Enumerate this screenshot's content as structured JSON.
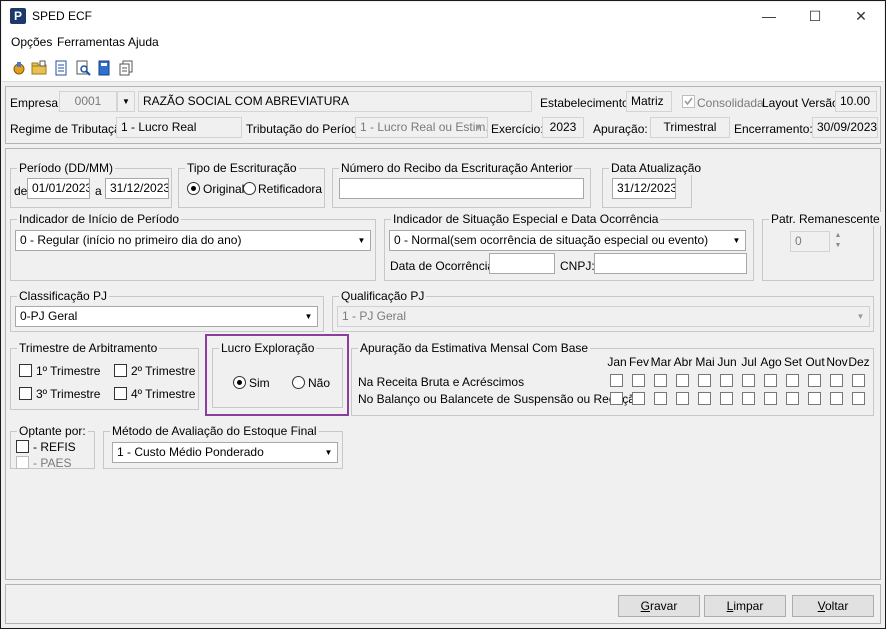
{
  "window": {
    "title": "SPED ECF",
    "logo_letter": "P",
    "minimize": "—",
    "maximize": "☐",
    "close": "✕"
  },
  "menu": [
    "Opções",
    "Ferramentas",
    "Ajuda"
  ],
  "toolbar_icons": [
    "tools-icon",
    "folder-icon",
    "document-icon",
    "search-document-icon",
    "book-icon",
    "copy-icon"
  ],
  "header": {
    "empresa_label": "Empresa:",
    "empresa_code": "0001",
    "empresa_name": "RAZÃO SOCIAL COM ABREVIATURA",
    "estabelecimento_label": "Estabelecimento:",
    "estabelecimento_value": "Matriz",
    "consolidada_label": "Consolidada",
    "layout_label": "Layout Versão:",
    "layout_value": "10.00",
    "regime_label": "Regime de Tributação:",
    "regime_value": "1 - Lucro Real",
    "tributacao_label": "Tributação do Período:",
    "tributacao_value": "1 - Lucro Real ou Estim.",
    "exercicio_label": "Exercício:",
    "exercicio_value": "2023",
    "apuracao_label": "Apuração:",
    "apuracao_value": "Trimestral",
    "encerramento_label": "Encerramento:",
    "encerramento_value": "30/09/2023"
  },
  "periodo": {
    "title": "Período (DD/MM)",
    "de_label": "de",
    "de_value": "01/01/2023",
    "a_label": "a",
    "a_value": "31/12/2023"
  },
  "tipo_escrituracao": {
    "title": "Tipo de Escrituração",
    "original": "Original",
    "retificadora": "Retificadora",
    "selected": "Original"
  },
  "recibo": {
    "title": "Número do Recibo da Escrituração Anterior",
    "value": ""
  },
  "data_atualizacao": {
    "title": "Data Atualização",
    "value": "31/12/2023"
  },
  "indicador_inicio": {
    "title": "Indicador de Início de Período",
    "value": "0 - Regular (início no primeiro dia do ano)"
  },
  "indicador_situacao": {
    "title": "Indicador de Situação Especial e Data Ocorrência",
    "value": "0 - Normal(sem ocorrência de situação especial ou evento)",
    "data_label": "Data de Ocorrência:",
    "data_value": "",
    "cnpj_label": "CNPJ:",
    "cnpj_value": ""
  },
  "patr_remanescente": {
    "title": "Patr. Remanescente",
    "value": "0"
  },
  "classificacao": {
    "title": "Classificação PJ",
    "value": "0-PJ Geral"
  },
  "qualificacao": {
    "title": "Qualificação PJ",
    "value": "1 - PJ Geral"
  },
  "trimestre_arbitramento": {
    "title": "Trimestre de Arbitramento",
    "items": [
      "1º Trimestre",
      "2º Trimestre",
      "3º Trimestre",
      "4º Trimestre"
    ]
  },
  "lucro_exploracao": {
    "title": "Lucro Exploração",
    "sim": "Sim",
    "nao": "Não",
    "selected": "Sim"
  },
  "apuracao_estimativa": {
    "title": "Apuração da Estimativa Mensal Com Base",
    "months": [
      "Jan",
      "Fev",
      "Mar",
      "Abr",
      "Mai",
      "Jun",
      "Jul",
      "Ago",
      "Set",
      "Out",
      "Nov",
      "Dez"
    ],
    "rows": [
      "Na Receita Bruta e Acréscimos",
      "No Balanço ou Balancete de Suspensão ou Redução"
    ]
  },
  "optante": {
    "title": "Optante por:",
    "refis": "- REFIS",
    "paes": "- PAES"
  },
  "metodo_estoque": {
    "title": "Método de Avaliação do Estoque Final",
    "value": "1 - Custo Médio Ponderado"
  },
  "buttons": {
    "gravar_u": "G",
    "gravar_rest": "ravar",
    "limpar_u": "L",
    "limpar_rest": "impar",
    "voltar_u": "V",
    "voltar_rest": "oltar"
  },
  "colors": {
    "highlight_border": "#8a3f9e",
    "logo_bg": "#1b3a6b"
  }
}
